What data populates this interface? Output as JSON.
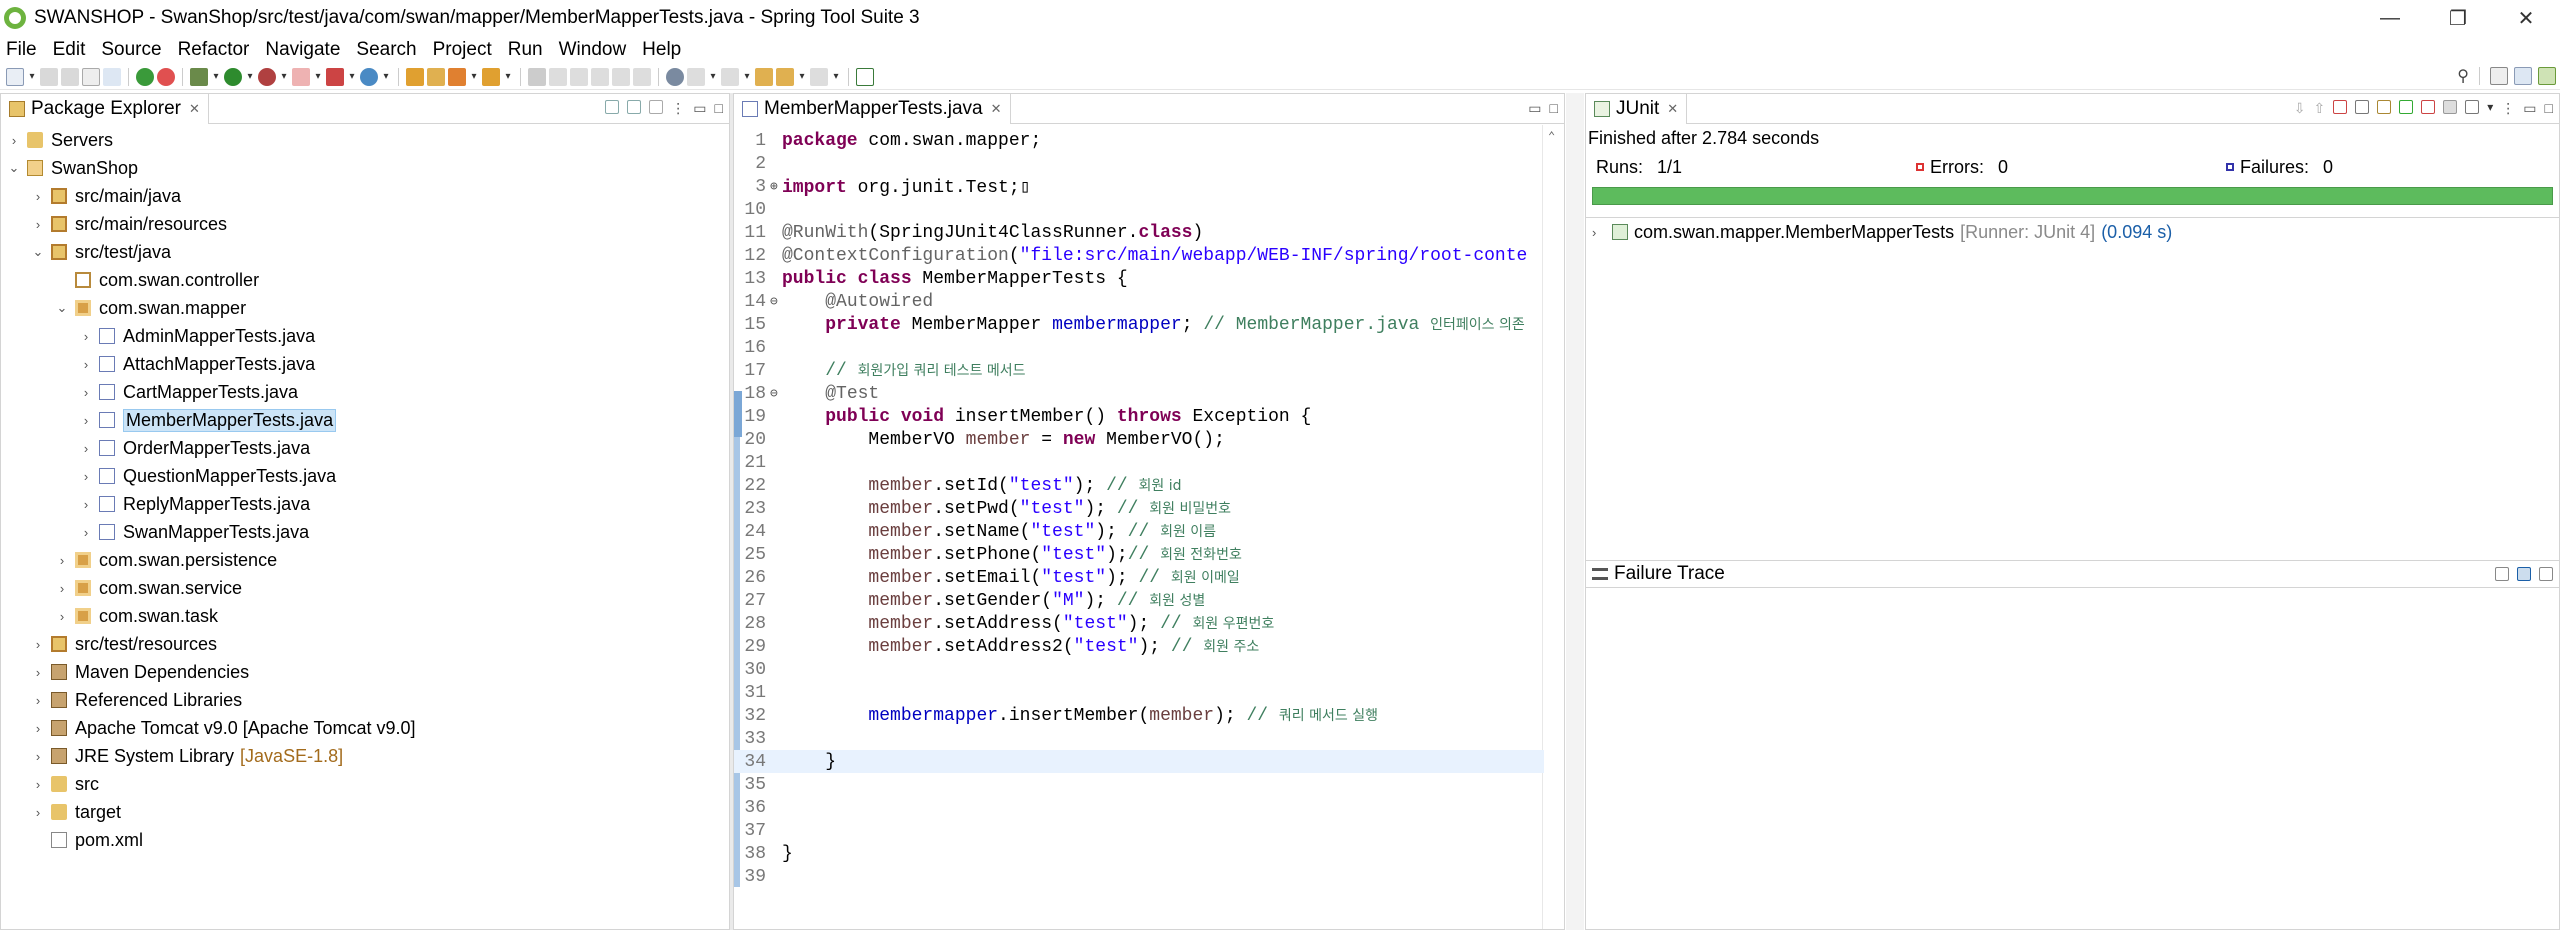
{
  "window": {
    "title": "SWANSHOP - SwanShop/src/test/java/com/swan/mapper/MemberMapperTests.java - Spring Tool Suite 3",
    "minimize": "—",
    "restore": "❐",
    "close": "✕"
  },
  "menu": [
    "File",
    "Edit",
    "Source",
    "Refactor",
    "Navigate",
    "Search",
    "Project",
    "Run",
    "Window",
    "Help"
  ],
  "explorer": {
    "tab_label": "Package Explorer",
    "tree": [
      {
        "label": "Servers",
        "indent": 0,
        "twisty": "›",
        "icon": "folder"
      },
      {
        "label": "SwanShop",
        "indent": 0,
        "twisty": "⌄",
        "icon": "project"
      },
      {
        "label": "src/main/java",
        "indent": 1,
        "twisty": "›",
        "icon": "srcfolder"
      },
      {
        "label": "src/main/resources",
        "indent": 1,
        "twisty": "›",
        "icon": "srcfolder"
      },
      {
        "label": "src/test/java",
        "indent": 1,
        "twisty": "⌄",
        "icon": "srcfolder"
      },
      {
        "label": "com.swan.controller",
        "indent": 2,
        "twisty": "",
        "icon": "pkg-empty"
      },
      {
        "label": "com.swan.mapper",
        "indent": 2,
        "twisty": "⌄",
        "icon": "package"
      },
      {
        "label": "AdminMapperTests.java",
        "indent": 3,
        "twisty": "›",
        "icon": "java"
      },
      {
        "label": "AttachMapperTests.java",
        "indent": 3,
        "twisty": "›",
        "icon": "java"
      },
      {
        "label": "CartMapperTests.java",
        "indent": 3,
        "twisty": "›",
        "icon": "java"
      },
      {
        "label": "MemberMapperTests.java",
        "indent": 3,
        "twisty": "›",
        "icon": "java",
        "selected": true
      },
      {
        "label": "OrderMapperTests.java",
        "indent": 3,
        "twisty": "›",
        "icon": "java"
      },
      {
        "label": "QuestionMapperTests.java",
        "indent": 3,
        "twisty": "›",
        "icon": "java"
      },
      {
        "label": "ReplyMapperTests.java",
        "indent": 3,
        "twisty": "›",
        "icon": "java"
      },
      {
        "label": "SwanMapperTests.java",
        "indent": 3,
        "twisty": "›",
        "icon": "java"
      },
      {
        "label": "com.swan.persistence",
        "indent": 2,
        "twisty": "›",
        "icon": "package"
      },
      {
        "label": "com.swan.service",
        "indent": 2,
        "twisty": "›",
        "icon": "package"
      },
      {
        "label": "com.swan.task",
        "indent": 2,
        "twisty": "›",
        "icon": "package"
      },
      {
        "label": "src/test/resources",
        "indent": 1,
        "twisty": "›",
        "icon": "srcfolder"
      },
      {
        "label": "Maven Dependencies",
        "indent": 1,
        "twisty": "›",
        "icon": "jar"
      },
      {
        "label": "Referenced Libraries",
        "indent": 1,
        "twisty": "›",
        "icon": "jar"
      },
      {
        "label": "Apache Tomcat v9.0 [Apache Tomcat v9.0]",
        "indent": 1,
        "twisty": "›",
        "icon": "jar"
      },
      {
        "label": "JRE System Library",
        "decor": "[JavaSE-1.8]",
        "indent": 1,
        "twisty": "›",
        "icon": "jar"
      },
      {
        "label": "src",
        "indent": 1,
        "twisty": "›",
        "icon": "folder"
      },
      {
        "label": "target",
        "indent": 1,
        "twisty": "›",
        "icon": "folder"
      },
      {
        "label": "pom.xml",
        "indent": 1,
        "twisty": "",
        "icon": "xml"
      }
    ]
  },
  "editor": {
    "tab_label": "MemberMapperTests.java",
    "current_line": "34",
    "lines": [
      {
        "n": "1",
        "segs": [
          [
            "kw",
            "package"
          ],
          [
            "",
            " com.swan.mapper;"
          ]
        ]
      },
      {
        "n": "2",
        "segs": []
      },
      {
        "n": "3",
        "mk": "⊕",
        "segs": [
          [
            "kw",
            "import"
          ],
          [
            "",
            " org.junit.Test;▯"
          ]
        ]
      },
      {
        "n": "10",
        "segs": []
      },
      {
        "n": "11",
        "segs": [
          [
            "ann",
            "@RunWith"
          ],
          [
            "",
            "(SpringJUnit4ClassRunner."
          ],
          [
            "kw",
            "class"
          ],
          [
            "",
            ")"
          ]
        ]
      },
      {
        "n": "12",
        "segs": [
          [
            "ann",
            "@ContextConfiguration"
          ],
          [
            "",
            "("
          ],
          [
            "str",
            "\"file:src/main/webapp/WEB-INF/spring/root-conte"
          ]
        ]
      },
      {
        "n": "13",
        "segs": [
          [
            "kw",
            "public class"
          ],
          [
            "",
            " MemberMapperTests {"
          ]
        ]
      },
      {
        "n": "14",
        "mk": "⊖",
        "segs": [
          [
            "",
            "    "
          ],
          [
            "ann",
            "@Autowired"
          ]
        ]
      },
      {
        "n": "15",
        "segs": [
          [
            "",
            "    "
          ],
          [
            "kw",
            "private"
          ],
          [
            "",
            " MemberMapper "
          ],
          [
            "fld",
            "membermapper"
          ],
          [
            "",
            "; "
          ],
          [
            "cmt",
            "// MemberMapper.java "
          ],
          [
            "cmt-kr",
            "인터페이스 의존"
          ]
        ]
      },
      {
        "n": "16",
        "segs": []
      },
      {
        "n": "17",
        "segs": [
          [
            "",
            "    "
          ],
          [
            "cmt",
            "// "
          ],
          [
            "cmt-kr",
            "회원가입 쿼리 테스트 메서드"
          ]
        ]
      },
      {
        "n": "18",
        "mk": "⊖",
        "segs": [
          [
            "",
            "    "
          ],
          [
            "ann",
            "@Test"
          ]
        ]
      },
      {
        "n": "19",
        "segs": [
          [
            "",
            "    "
          ],
          [
            "kw",
            "public void"
          ],
          [
            "",
            " insertMember() "
          ],
          [
            "kw",
            "throws"
          ],
          [
            "",
            " Exception {"
          ]
        ]
      },
      {
        "n": "20",
        "segs": [
          [
            "",
            "        MemberVO "
          ],
          [
            "cmt-var",
            "member"
          ],
          [
            "",
            " = "
          ],
          [
            "kw",
            "new"
          ],
          [
            "",
            " MemberVO();"
          ]
        ]
      },
      {
        "n": "21",
        "segs": []
      },
      {
        "n": "22",
        "segs": [
          [
            "",
            "        "
          ],
          [
            "cmt-var",
            "member"
          ],
          [
            "",
            ".setId("
          ],
          [
            "str",
            "\"test\""
          ],
          [
            "",
            "); "
          ],
          [
            "cmt",
            "// "
          ],
          [
            "cmt-kr",
            "회원 id"
          ]
        ]
      },
      {
        "n": "23",
        "segs": [
          [
            "",
            "        "
          ],
          [
            "cmt-var",
            "member"
          ],
          [
            "",
            ".setPwd("
          ],
          [
            "str",
            "\"test\""
          ],
          [
            "",
            "); "
          ],
          [
            "cmt",
            "// "
          ],
          [
            "cmt-kr",
            "회원 비밀번호"
          ]
        ]
      },
      {
        "n": "24",
        "segs": [
          [
            "",
            "        "
          ],
          [
            "cmt-var",
            "member"
          ],
          [
            "",
            ".setName("
          ],
          [
            "str",
            "\"test\""
          ],
          [
            "",
            "); "
          ],
          [
            "cmt",
            "// "
          ],
          [
            "cmt-kr",
            "회원 이름"
          ]
        ]
      },
      {
        "n": "25",
        "segs": [
          [
            "",
            "        "
          ],
          [
            "cmt-var",
            "member"
          ],
          [
            "",
            ".setPhone("
          ],
          [
            "str",
            "\"test\""
          ],
          [
            "",
            ");"
          ],
          [
            "cmt",
            "// "
          ],
          [
            "cmt-kr",
            "회원 전화번호"
          ]
        ]
      },
      {
        "n": "26",
        "segs": [
          [
            "",
            "        "
          ],
          [
            "cmt-var",
            "member"
          ],
          [
            "",
            ".setEmail("
          ],
          [
            "str",
            "\"test\""
          ],
          [
            "",
            "); "
          ],
          [
            "cmt",
            "// "
          ],
          [
            "cmt-kr",
            "회원 이메일"
          ]
        ]
      },
      {
        "n": "27",
        "segs": [
          [
            "",
            "        "
          ],
          [
            "cmt-var",
            "member"
          ],
          [
            "",
            ".setGender("
          ],
          [
            "str",
            "\"M\""
          ],
          [
            "",
            "); "
          ],
          [
            "cmt",
            "// "
          ],
          [
            "cmt-kr",
            "회원 성별"
          ]
        ]
      },
      {
        "n": "28",
        "segs": [
          [
            "",
            "        "
          ],
          [
            "cmt-var",
            "member"
          ],
          [
            "",
            ".setAddress("
          ],
          [
            "str",
            "\"test\""
          ],
          [
            "",
            "); "
          ],
          [
            "cmt",
            "// "
          ],
          [
            "cmt-kr",
            "회원 우편번호"
          ]
        ]
      },
      {
        "n": "29",
        "segs": [
          [
            "",
            "        "
          ],
          [
            "cmt-var",
            "member"
          ],
          [
            "",
            ".setAddress2("
          ],
          [
            "str",
            "\"test\""
          ],
          [
            "",
            "); "
          ],
          [
            "cmt",
            "// "
          ],
          [
            "cmt-kr",
            "회원 주소"
          ]
        ]
      },
      {
        "n": "30",
        "segs": []
      },
      {
        "n": "31",
        "segs": []
      },
      {
        "n": "32",
        "segs": [
          [
            "",
            "        "
          ],
          [
            "fld",
            "membermapper"
          ],
          [
            "",
            ".insertMember("
          ],
          [
            "cmt-var",
            "member"
          ],
          [
            "",
            "); "
          ],
          [
            "cmt",
            "// "
          ],
          [
            "cmt-kr",
            "쿼리 메서드 실행"
          ]
        ]
      },
      {
        "n": "33",
        "segs": []
      },
      {
        "n": "34",
        "segs": [
          [
            "",
            "    }"
          ]
        ]
      },
      {
        "n": "35",
        "segs": []
      },
      {
        "n": "36",
        "segs": []
      },
      {
        "n": "37",
        "segs": []
      },
      {
        "n": "38",
        "segs": [
          [
            "",
            "}"
          ]
        ]
      },
      {
        "n": "39",
        "segs": []
      }
    ]
  },
  "junit": {
    "tab_label": "JUnit",
    "finished": "Finished after 2.784 seconds",
    "runs_label": "Runs:",
    "runs_value": "1/1",
    "errors_label": "Errors:",
    "errors_value": "0",
    "failures_label": "Failures:",
    "failures_value": "0",
    "result_name": "com.swan.mapper.MemberMapperTests",
    "result_runner": "[Runner: JUnit 4]",
    "result_time": "(0.094 s)",
    "failure_trace_label": "Failure Trace",
    "progress": 1.0
  },
  "colors": {
    "progress_green": "#5dbb5d",
    "selection": "#cce4f7",
    "keyword": "#7f0055",
    "string": "#2a00ff",
    "comment": "#3f7f5f",
    "field": "#0000c0"
  }
}
